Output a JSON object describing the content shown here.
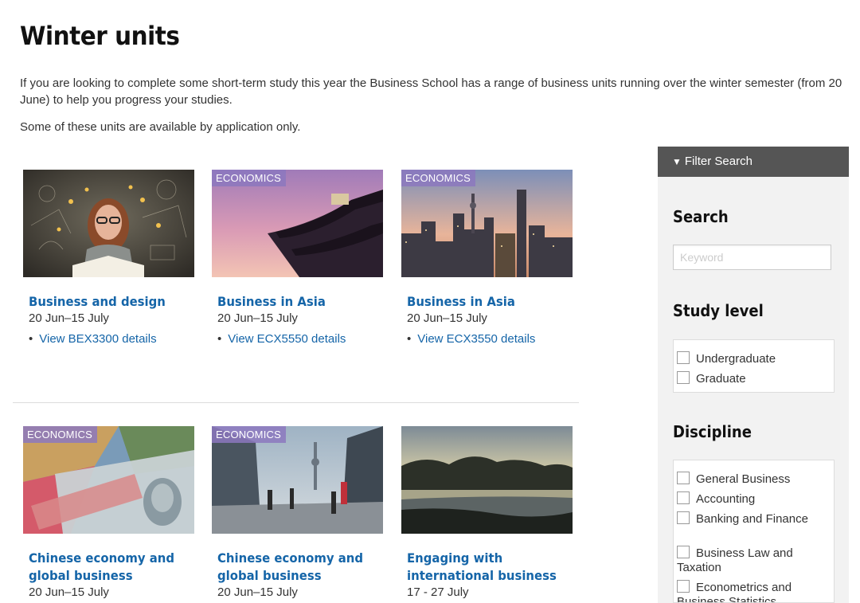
{
  "page": {
    "title": "Winter units",
    "intro": "If you are looking to complete some short-term study this year the Business School has a range of business units running over the winter semester (from 20 June) to help you progress your studies.",
    "note": "Some of these units are available by application only."
  },
  "cards": [
    {
      "tag": "",
      "title": "Business and design",
      "date": "20 Jun–15 July",
      "link": "View BEX3300 details",
      "image": "woman-reading-book-with-ideas"
    },
    {
      "tag": "ECONOMICS",
      "title": "Business in Asia",
      "date": "20 Jun–15 July",
      "link": "View ECX5550 details",
      "image": "asian-temple-roof-sunset"
    },
    {
      "tag": "ECONOMICS",
      "title": "Business in Asia",
      "date": "20 Jun–15 July",
      "link": "View ECX3550 details",
      "image": "city-skyline-dusk"
    },
    {
      "tag": "ECONOMICS",
      "title": "Chinese economy and global business",
      "date": "20 Jun–15 July",
      "link": "",
      "image": "banknotes-on-map"
    },
    {
      "tag": "ECONOMICS",
      "title": "Chinese economy and global business",
      "date": "20 Jun–15 July",
      "link": "",
      "image": "city-street-pedestrians"
    },
    {
      "tag": "",
      "title": "Engaging with international business",
      "date": "17 - 27 July",
      "link": "",
      "image": "lake-sunset"
    }
  ],
  "filter": {
    "header": "Filter Search",
    "header_icon": "funnel-icon",
    "search_heading": "Search",
    "keyword_placeholder": "Keyword",
    "keyword_value": "",
    "study_level_heading": "Study level",
    "study_levels": [
      "Undergraduate",
      "Graduate"
    ],
    "discipline_heading": "Discipline",
    "disciplines": [
      "General Business",
      "Accounting",
      "Banking and Finance",
      "Business Law and Taxation",
      "Econometrics and Business Statistics"
    ]
  },
  "colors": {
    "link": "#1565a8",
    "tag_bg": "#8c78be",
    "filter_header_bg": "#555555",
    "panel_bg": "#f2f2f2"
  }
}
